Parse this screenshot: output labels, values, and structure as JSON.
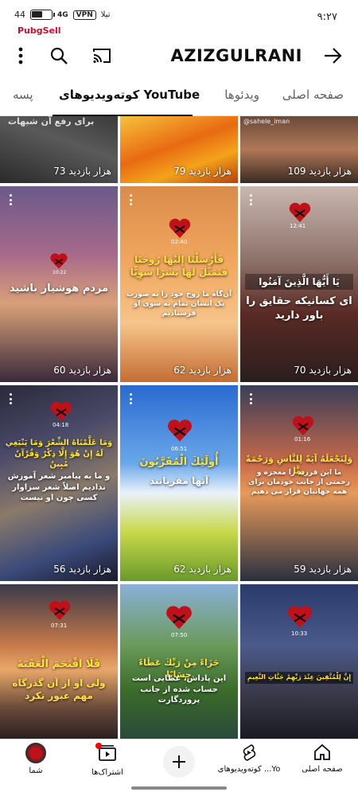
{
  "status_bar": {
    "time": "۹:۲۷",
    "battery": "44",
    "network": "4G",
    "vpn": "VPN",
    "carrier_icon": "تیلا"
  },
  "watermark_logo": "PubgSell",
  "header": {
    "channel_name": "AZIZGULRANI",
    "icons": [
      "forward-arrow-icon",
      "cast-icon",
      "search-icon",
      "more-vert-icon"
    ]
  },
  "tabs": [
    {
      "label": "صفحه اصلی",
      "active": false
    },
    {
      "label": "ویدئوها",
      "active": false
    },
    {
      "label": "کوته‌ویدیوهای YouTube",
      "active": true
    },
    {
      "label": "پسه",
      "active": false
    }
  ],
  "shorts": [
    {
      "views": "109 هزار بازدید",
      "top_caption": "@sahele_iman"
    },
    {
      "views": "79 هزار بازدید"
    },
    {
      "views": "73 هزار بازدید",
      "top_caption": "برای رفع آن شبهات"
    },
    {
      "views": "70 هزار بازدید",
      "heart_time": "12:41",
      "arabic": "يَا أَيُّهَا الَّذِينَ آمَنُوا",
      "persian": "ای کسانیکه حقایق را باور دارید"
    },
    {
      "views": "62 هزار بازدید",
      "heart_time": "02:40",
      "arabic": "فَأَرْسَلْنَا إِلَيْهَا رُوحَنَا فَتَمَثَّلَ لَهَا بَشَرًا سَوِيًّا",
      "persian": "آن‌گاه ما روح خود را به صورت یک انسان تمام به سوی او فرستادیم"
    },
    {
      "views": "60 هزار بازدید",
      "heart_time": "10:22",
      "persian": "مردم هوشیار باشید"
    },
    {
      "views": "59 هزار بازدید",
      "heart_time": "01:16",
      "arabic": "وَلِنَجْعَلَهُ آيَةً لِلنَّاسِ وَرَحْمَةً مِنَّا",
      "persian": "ما این فرزند را معجزه و رحمتی از جانب خودمان برای همه جهانیان قرار می دهیم"
    },
    {
      "views": "62 هزار بازدید",
      "heart_time": "06:51",
      "arabic": "أُولَئِكَ الْمُقَرَّبُونَ",
      "persian": "آنها مقربانند"
    },
    {
      "views": "56 هزار بازدید",
      "heart_time": "04:18",
      "arabic": "وَمَا عَلَّمْنَاهُ الشِّعْرَ وَمَا يَنْبَغِي لَهُ إِنْ هُوَ إِلَّا ذِكْرٌ وَقُرْآنٌ مُبِينٌ",
      "persian": "و ما به پیامبر شعر آموزش ندادیم اصلاً شعر سزاوار کسی چون او نیست"
    },
    {
      "views": "",
      "heart_time": "10:33",
      "arabic": "إِنَّ لِلْمُتَّقِينَ عِنْدَ رَبِّهِمْ جَنَّاتِ النَّعِيمِ",
      "persian": ""
    },
    {
      "views": "",
      "heart_time": "07:50",
      "arabic": "جَزَاءً مِنْ رَبِّكَ عَطَاءً حِسَابًا",
      "persian": "این پاداش، عطایی است حساب شده از جانب پروردگارت"
    },
    {
      "views": "",
      "heart_time": "07:31",
      "arabic": "فَلَا اقْتَحَمَ الْعَقَبَةَ",
      "persian": "ولی او از آن گذرگاه مهم عبور نکرد"
    }
  ],
  "bottom_nav": [
    {
      "label": "صفحه اصلی",
      "icon": "home-icon"
    },
    {
      "label": "کوته‌ویدیوهای ...Yo",
      "icon": "shorts-icon"
    },
    {
      "label": "",
      "icon": "plus-icon"
    },
    {
      "label": "اشتراک‌ها",
      "icon": "subscriptions-icon"
    },
    {
      "label": "شما",
      "icon": "avatar"
    }
  ],
  "colors": {
    "accent": "#ff0000",
    "text": "#0f0f0f",
    "subtext": "#606060"
  }
}
